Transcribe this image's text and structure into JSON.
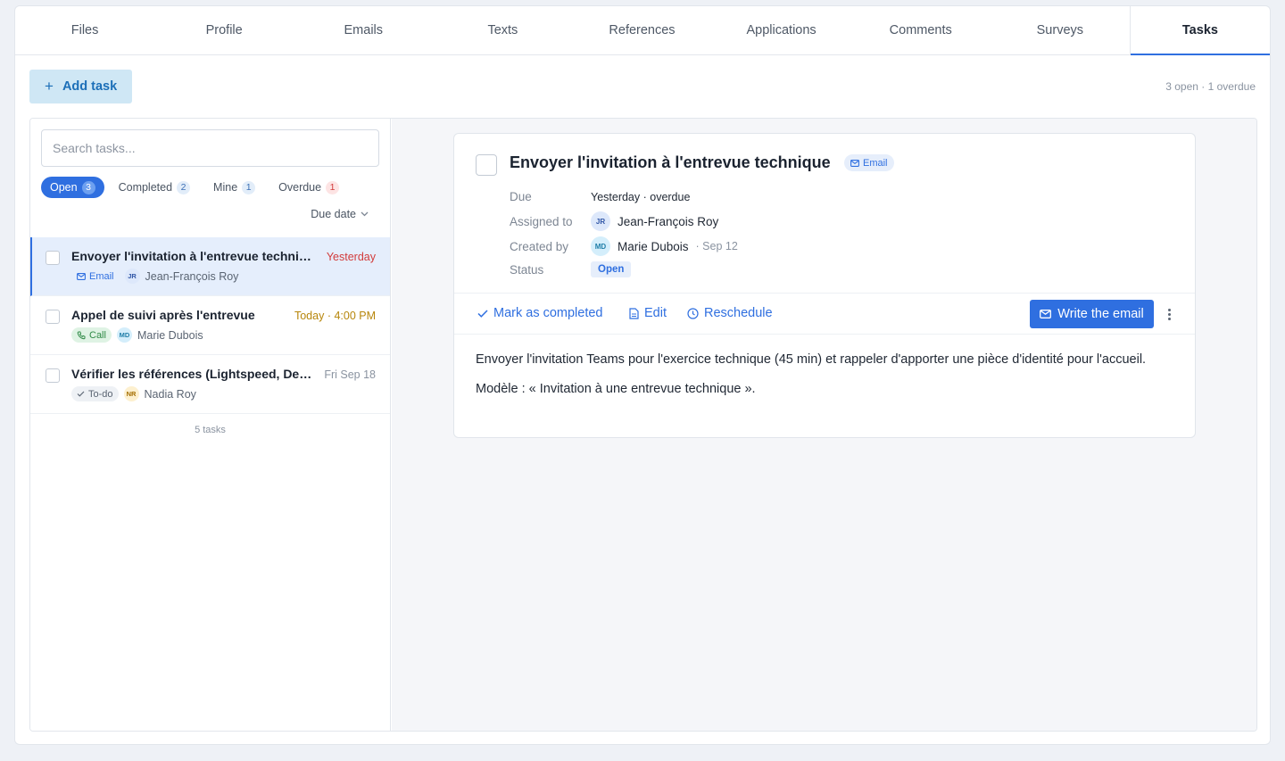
{
  "tabs": [
    {
      "label": "Files"
    },
    {
      "label": "Profile"
    },
    {
      "label": "Emails"
    },
    {
      "label": "Texts"
    },
    {
      "label": "References"
    },
    {
      "label": "Applications"
    },
    {
      "label": "Comments"
    },
    {
      "label": "Surveys"
    },
    {
      "label": "Tasks",
      "active": true
    }
  ],
  "toolbar": {
    "add_label": "Add task",
    "summary": "3 open · 1 overdue"
  },
  "search": {
    "placeholder": "Search tasks...",
    "value": ""
  },
  "filters": [
    {
      "label": "Open",
      "count": "3",
      "active": true
    },
    {
      "label": "Completed",
      "count": "2"
    },
    {
      "label": "Mine",
      "count": "1"
    },
    {
      "label": "Overdue",
      "count": "1"
    }
  ],
  "sort": {
    "label": "Due date"
  },
  "tasks": [
    {
      "title": "Envoyer l'invitation à l'entrevue technique",
      "when": "Yesterday",
      "when_color": "#d23b3b",
      "type": "Email",
      "assignee_initials": "JR",
      "assignee": "Jean-François Roy",
      "selected": true
    },
    {
      "title": "Appel de suivi après l'entrevue",
      "when": "Today · 4:00 PM",
      "when_color": "#b7860b",
      "type": "Call",
      "assignee_initials": "MD",
      "assignee": "Marie Dubois"
    },
    {
      "title": "Vérifier les références (Lightspeed, Desjardins)",
      "when": "Fri Sep 18",
      "when_color": "#8a93a0",
      "type": "To-do",
      "assignee_initials": "NR",
      "assignee": "Nadia Roy"
    }
  ],
  "tasks_total": "5 tasks",
  "detail": {
    "title": "Envoyer l'invitation à l'entrevue technique",
    "type": "Email",
    "due_label": "Due",
    "due_value": "Yesterday · overdue",
    "assigned_label": "Assigned to",
    "assigned_initials": "JR",
    "assigned_value": "Jean-François Roy",
    "created_label": "Created by",
    "created_initials": "MD",
    "created_value": "Marie Dubois",
    "created_date": "· Sep 12",
    "status_label": "Status",
    "status_value": "Open",
    "actions": {
      "complete": "Mark as completed",
      "edit": "Edit",
      "reschedule": "Reschedule",
      "write": "Write the email"
    },
    "body": [
      "Envoyer l'invitation Teams pour l'exercice technique (45 min) et rappeler d'apporter une pièce d'identité pour l'accueil.",
      "Modèle : « Invitation à une entrevue technique »."
    ]
  },
  "colors": {
    "accent": "#2f6fe0",
    "overdue": "#d23b3b",
    "today": "#b7860b"
  }
}
